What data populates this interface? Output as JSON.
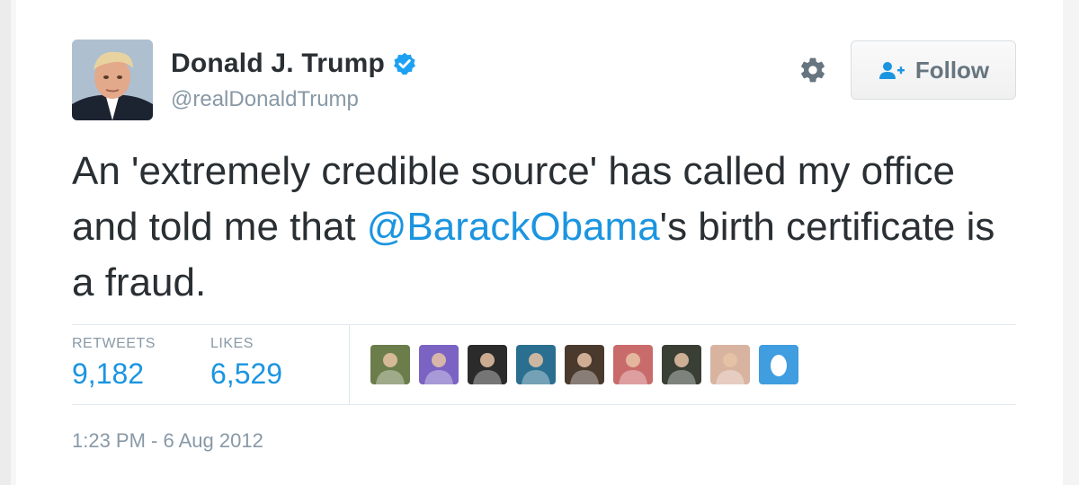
{
  "user": {
    "display_name": "Donald J. Trump",
    "handle": "@realDonaldTrump",
    "verified": true
  },
  "actions": {
    "follow_label": "Follow"
  },
  "tweet": {
    "text_before": "An 'extremely credible source' has called my office and told me that ",
    "mention": "@BarackObama",
    "text_after": "'s birth certificate is a fraud."
  },
  "stats": {
    "retweets_label": "RETWEETS",
    "retweets_value": "9,182",
    "likes_label": "LIKES",
    "likes_value": "6,529"
  },
  "likers": [
    {
      "icon": "liker-avatar-1",
      "color": "#6b7d4a"
    },
    {
      "icon": "liker-avatar-2",
      "color": "#7a63c2"
    },
    {
      "icon": "liker-avatar-3",
      "color": "#2b2b2b"
    },
    {
      "icon": "liker-avatar-4",
      "color": "#2a6f8f"
    },
    {
      "icon": "liker-avatar-5",
      "color": "#4a3a2e"
    },
    {
      "icon": "liker-avatar-6",
      "color": "#c96b6b"
    },
    {
      "icon": "liker-avatar-7",
      "color": "#3a3f36"
    },
    {
      "icon": "liker-avatar-8",
      "color": "#d8b3a0"
    },
    {
      "icon": "egg-avatar",
      "color": "#3f9de0"
    }
  ],
  "timestamp": "1:23 PM - 6 Aug 2012",
  "colors": {
    "link": "#1b95e0",
    "text": "#292f33",
    "muted": "#8899a6",
    "verified": "#1da1f2"
  }
}
